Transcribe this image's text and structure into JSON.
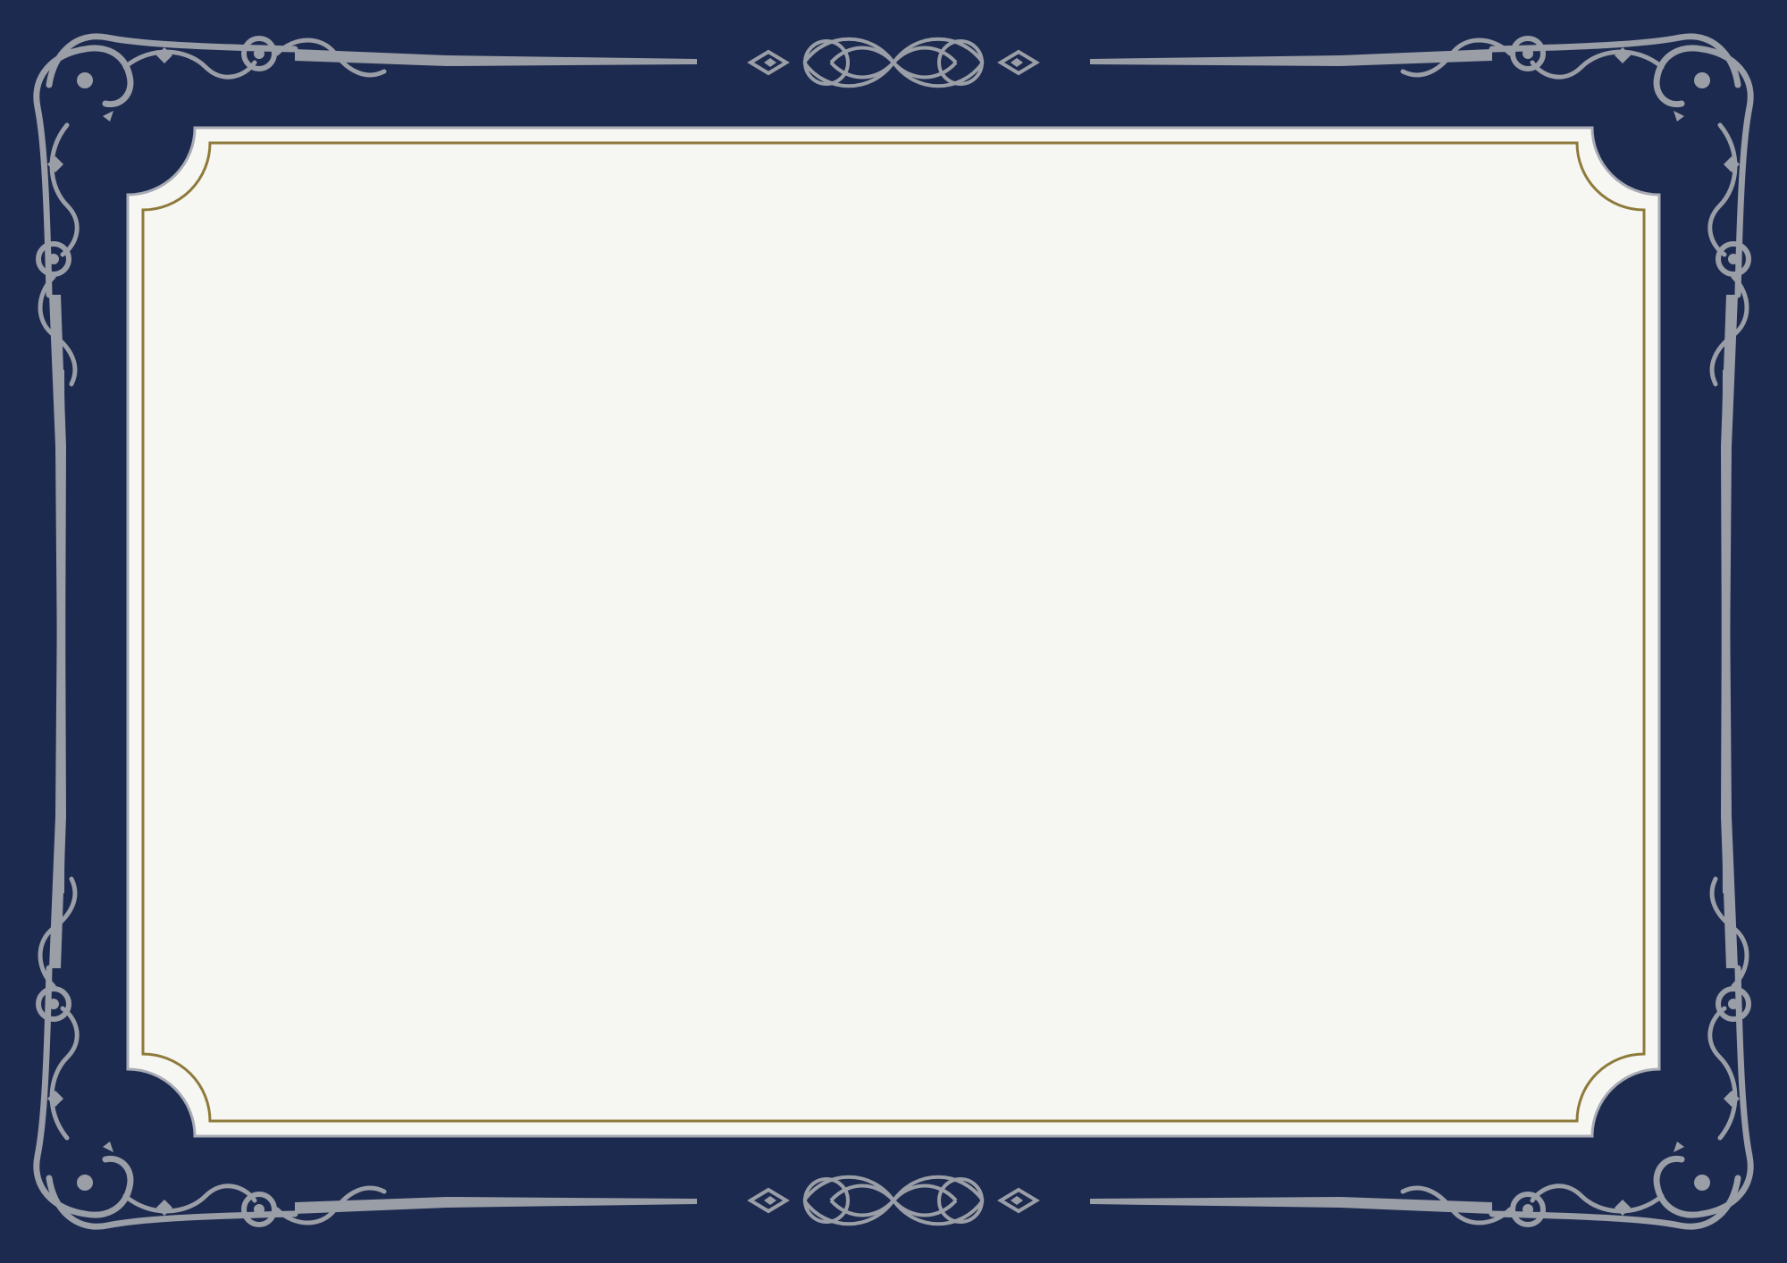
{
  "colors": {
    "background": "#1d2a4f",
    "ornament": "#9a9ea7",
    "panel": "#f6f6f3",
    "panel_edge": "#a7abb4",
    "accent_rule": "#8e7a3a"
  },
  "frame": {
    "style": "ornate-certificate-border",
    "corner_icon": "scroll-flourish-icon",
    "center_icon": "knot-flourish-icon"
  },
  "panel": {
    "content": ""
  }
}
